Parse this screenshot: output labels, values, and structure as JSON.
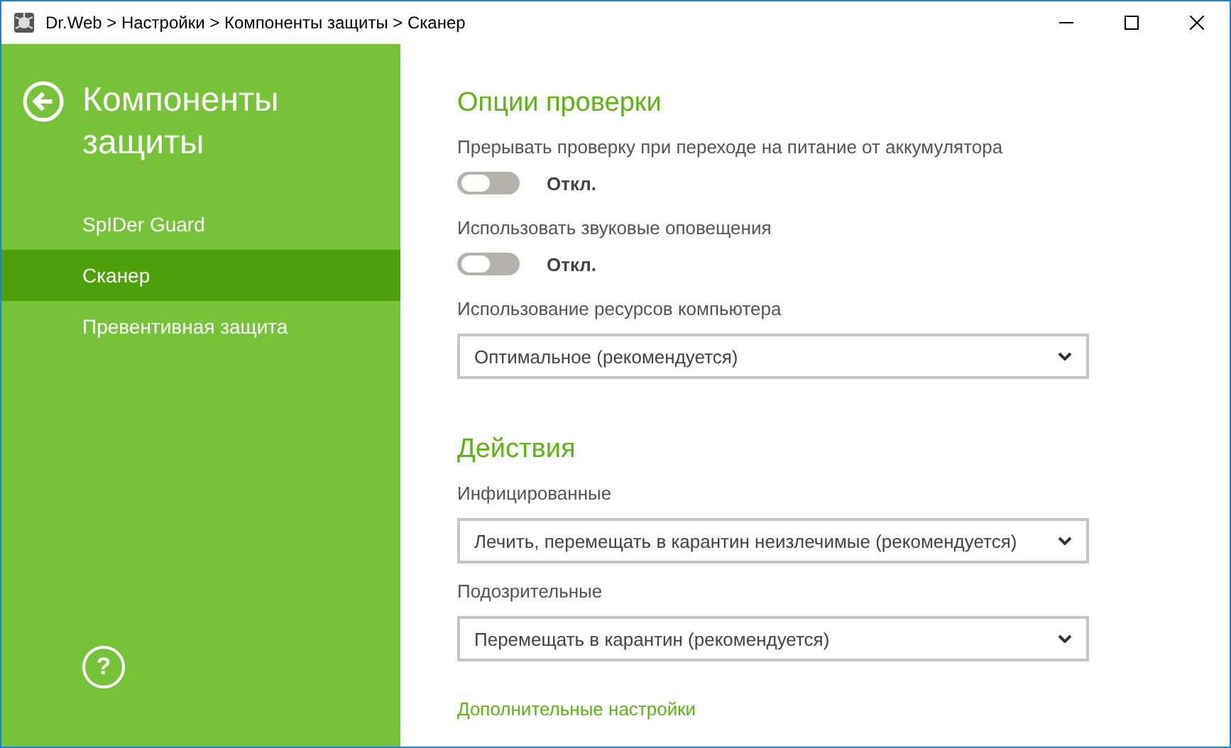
{
  "window": {
    "title": "Dr.Web > Настройки > Компоненты защиты > Сканер"
  },
  "sidebar": {
    "title": "Компоненты защиты",
    "items": [
      {
        "label": "SpIDer Guard",
        "selected": false
      },
      {
        "label": "Сканер",
        "selected": true
      },
      {
        "label": "Превентивная защита",
        "selected": false
      }
    ],
    "help": "?"
  },
  "sections": [
    {
      "heading": "Опции проверки",
      "settings": [
        {
          "kind": "toggle",
          "label": "Прерывать проверку при переходе на питание от аккумулятора",
          "on": false,
          "state_text": "Откл."
        },
        {
          "kind": "toggle",
          "label": "Использовать звуковые оповещения",
          "on": false,
          "state_text": "Откл."
        },
        {
          "kind": "dropdown",
          "label": "Использование ресурсов компьютера",
          "value": "Оптимальное (рекомендуется)"
        }
      ]
    },
    {
      "heading": "Действия",
      "settings": [
        {
          "kind": "dropdown",
          "label": "Инфицированные",
          "value": "Лечить, перемещать в карантин неизлечимые (рекомендуется)"
        },
        {
          "kind": "dropdown",
          "label": "Подозрительные",
          "value": "Перемещать в карантин (рекомендуется)"
        }
      ]
    }
  ],
  "link": "Дополнительные настройки"
}
